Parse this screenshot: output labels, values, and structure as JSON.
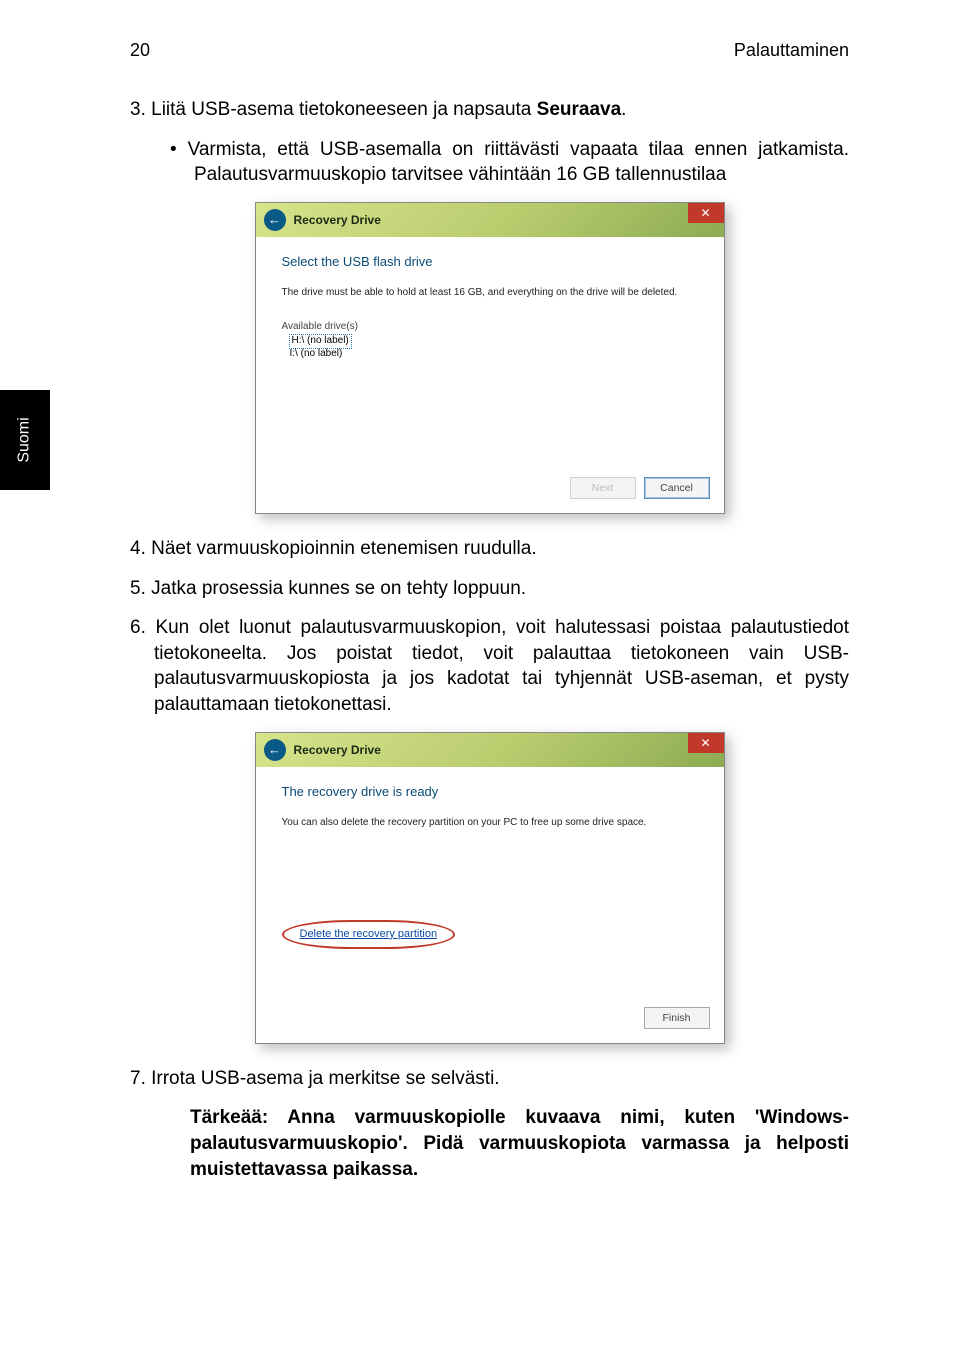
{
  "header": {
    "page_number": "20",
    "section": "Palauttaminen"
  },
  "side_tab": "Suomi",
  "steps": {
    "s3_prefix": "3. ",
    "s3_a": "Liitä USB-asema tietokoneeseen ja napsauta ",
    "s3_b": "Seuraava",
    "s3_c": ".",
    "s3_bullet": "Varmista, että USB-asemalla on riittävästi vapaata tilaa ennen jatkamista. Palautusvarmuuskopio tarvitsee vähintään 16 GB tallennustilaa",
    "s4": "4. Näet varmuuskopioinnin etenemisen ruudulla.",
    "s5": "5. Jatka prosessia kunnes se on tehty loppuun.",
    "s6": "6. Kun olet luonut palautusvarmuuskopion, voit halutessasi poistaa palautustiedot tietokoneelta. Jos poistat tiedot, voit palauttaa tietokoneen vain USB-palautusvarmuuskopiosta ja jos kadotat tai tyhjennät USB-aseman, et pysty palauttamaan tietokonettasi.",
    "s7": "7. Irrota USB-asema ja merkitse se selvästi.",
    "important": "Tärkeää: Anna varmuuskopiolle kuvaava nimi, kuten 'Windows-palautusvarmuuskopio'. Pidä varmuuskopiota varmassa ja helposti muistettavassa paikassa."
  },
  "dialog1": {
    "title": "Recovery Drive",
    "heading": "Select the USB flash drive",
    "subtext": "The drive must be able to hold at least 16 GB, and everything on the drive will be deleted.",
    "available": "Available drive(s)",
    "drive_h": "H:\\ (no label)",
    "drive_i": "I:\\ (no label)",
    "next": "Next",
    "cancel": "Cancel"
  },
  "dialog2": {
    "title": "Recovery Drive",
    "heading": "The recovery drive is ready",
    "subtext": "You can also delete the recovery partition on your PC to free up some drive space.",
    "delete_link": "Delete the recovery partition",
    "finish": "Finish"
  }
}
